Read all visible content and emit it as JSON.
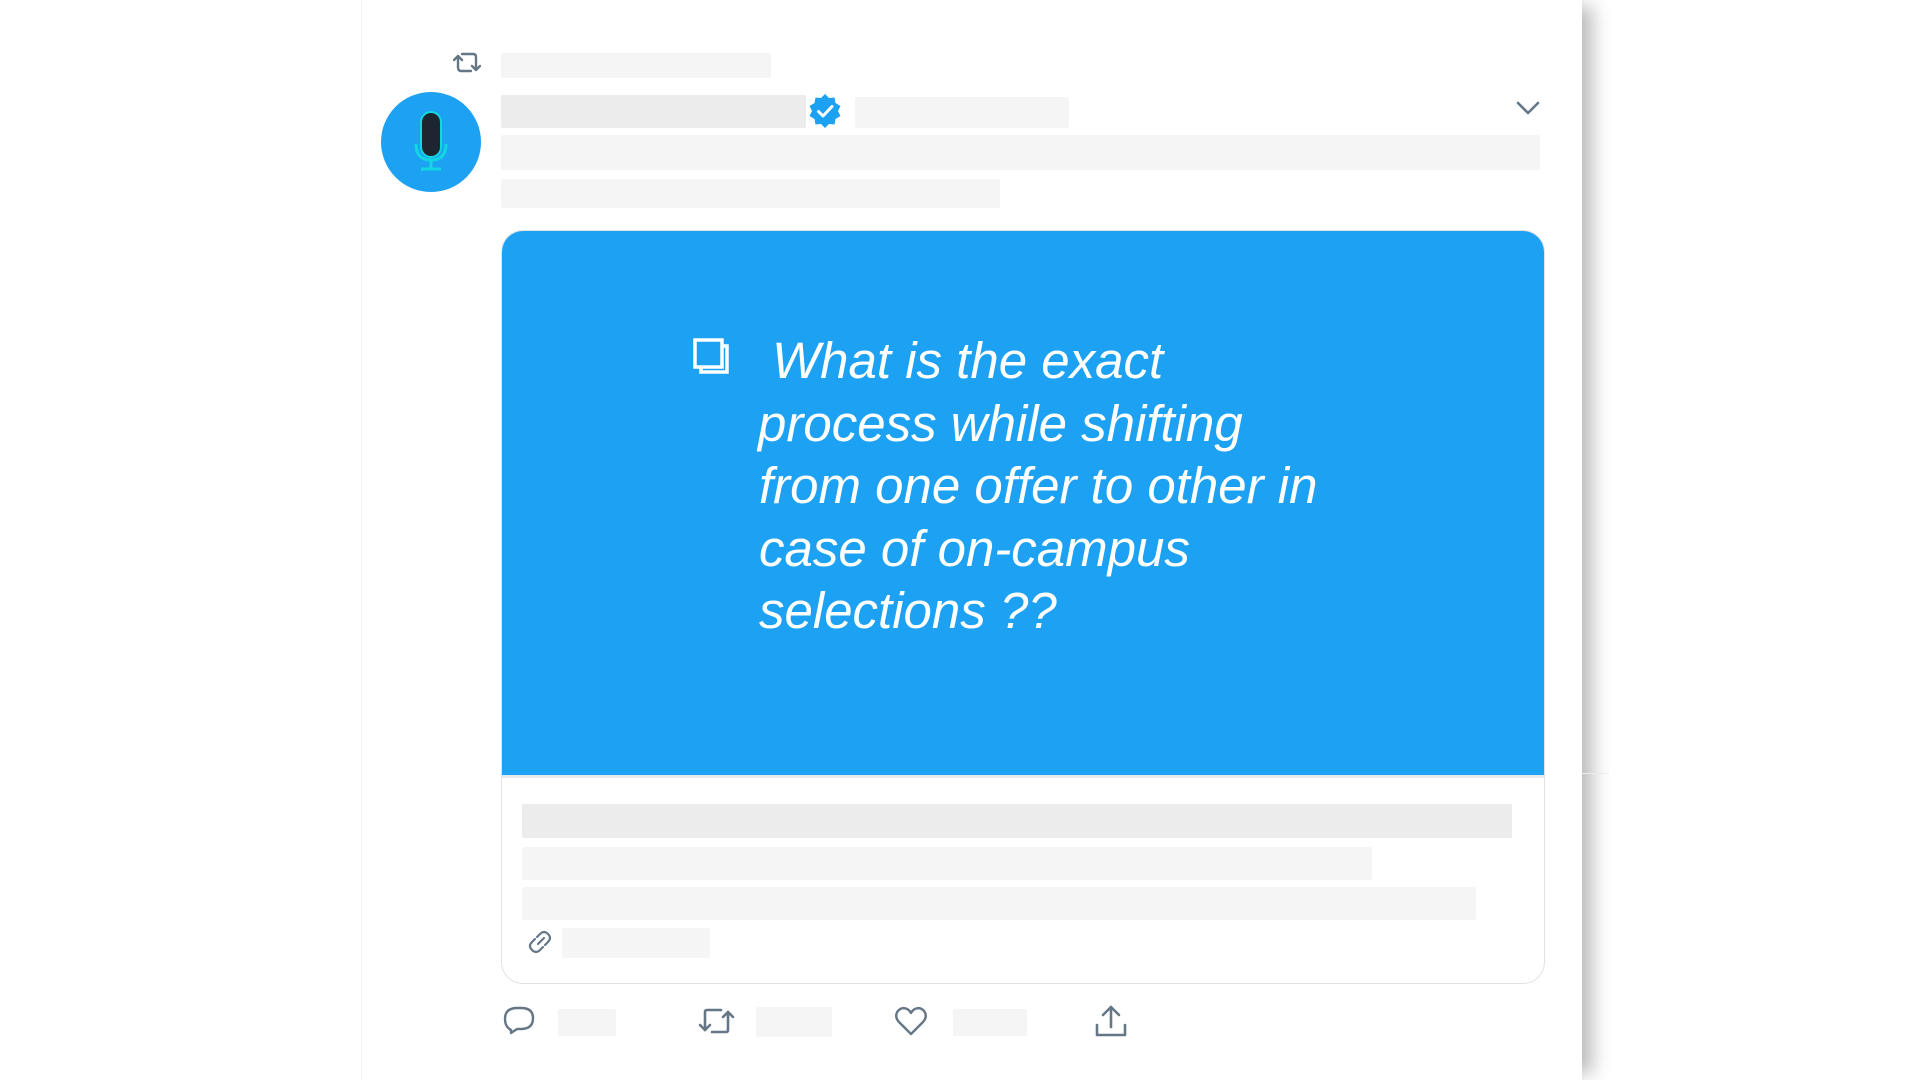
{
  "tweet": {
    "question": {
      "lines": [
        "What is the exact",
        "process while shifting",
        "from one offer to other in",
        "case of on-campus",
        "selections ??"
      ]
    }
  },
  "icons": {
    "retweet_context": "retweet-icon",
    "avatar": "microphone-icon",
    "verified": "verified-badge-icon",
    "menu": "chevron-down-icon",
    "question_bullet": "checkbox-icon",
    "card_link": "link-icon",
    "reply": "reply-icon",
    "retweet": "retweet-icon",
    "like": "heart-icon",
    "share": "share-icon"
  },
  "colors": {
    "brand_blue": "#1da1f2",
    "icon_gray": "#657786",
    "text_on_card": "#ffffff",
    "placeholder": "#f5f5f5"
  }
}
